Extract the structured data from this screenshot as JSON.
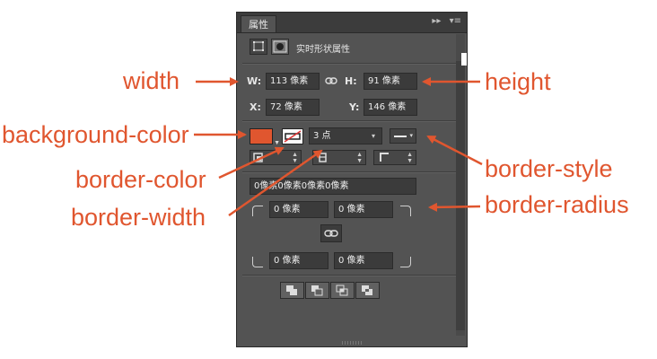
{
  "panel": {
    "tab_title": "属性",
    "header_title": "实时形状属性",
    "width_label": "W:",
    "width_value": "113 像素",
    "height_label": "H:",
    "height_value": "91 像素",
    "x_label": "X:",
    "x_value": "72 像素",
    "y_label": "Y:",
    "y_value": "146 像素",
    "stroke_width_value": "3 点",
    "radius_summary": "0像素0像素0像素0像素",
    "radius_tl": "0 像素",
    "radius_tr": "0 像素",
    "radius_bl": "0 像素",
    "radius_br": "0 像素",
    "fill_color": "#e0562f"
  },
  "annotations": {
    "width": "width",
    "height": "height",
    "background_color": "background-color",
    "border_color": "border-color",
    "border_width": "border-width",
    "border_style": "border-style",
    "border_radius": "border-radius",
    "color": "#e0562f"
  },
  "icons": [
    "rect-shape-icon",
    "mask-icon",
    "link-icon",
    "chevron-down-icon",
    "align-icon",
    "corner-icon",
    "pathfinder-icon",
    "panel-menu-icon",
    "expand-icon"
  ]
}
